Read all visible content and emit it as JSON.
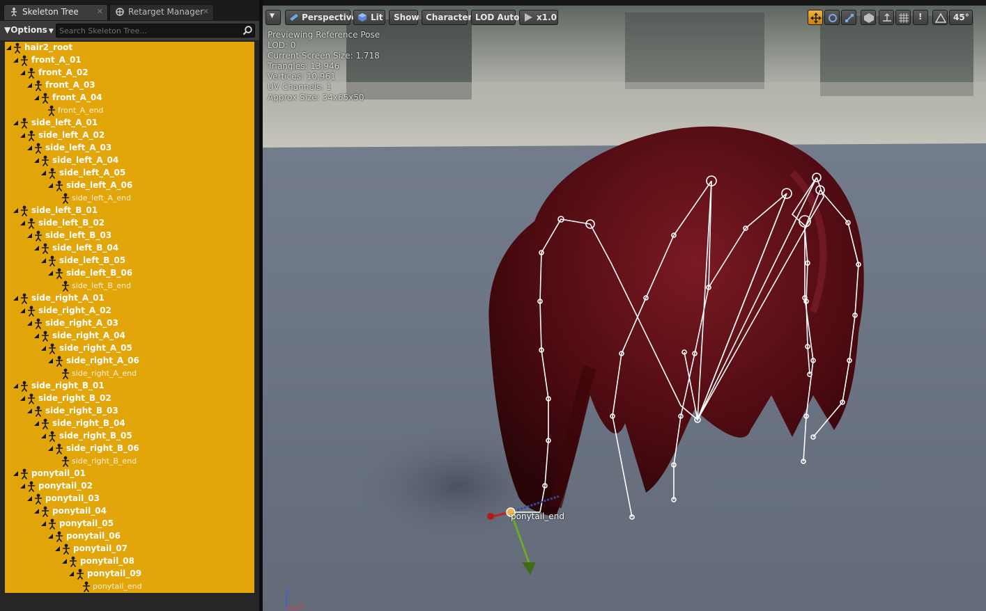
{
  "tabs": [
    {
      "label": "Skeleton Tree",
      "active": true
    },
    {
      "label": "Retarget Manager",
      "active": false
    }
  ],
  "toolbar": {
    "options_label": "Options"
  },
  "search": {
    "placeholder": "Search Skeleton Tree..."
  },
  "tree": [
    {
      "label": "hair2_root",
      "depth": 0
    },
    {
      "label": "front_A_01",
      "depth": 1
    },
    {
      "label": "front_A_02",
      "depth": 2
    },
    {
      "label": "front_A_03",
      "depth": 3
    },
    {
      "label": "front_A_04",
      "depth": 4
    },
    {
      "label": "front_A_end",
      "depth": 5,
      "leaf": true
    },
    {
      "label": "side_left_A_01",
      "depth": 1
    },
    {
      "label": "side_left_A_02",
      "depth": 2
    },
    {
      "label": "side_left_A_03",
      "depth": 3
    },
    {
      "label": "side_left_A_04",
      "depth": 4
    },
    {
      "label": "side_left_A_05",
      "depth": 5
    },
    {
      "label": "side_left_A_06",
      "depth": 6
    },
    {
      "label": "side_left_A_end",
      "depth": 7,
      "leaf": true
    },
    {
      "label": "side_left_B_01",
      "depth": 1
    },
    {
      "label": "side_left_B_02",
      "depth": 2
    },
    {
      "label": "side_left_B_03",
      "depth": 3
    },
    {
      "label": "side_left_B_04",
      "depth": 4
    },
    {
      "label": "side_left_B_05",
      "depth": 5
    },
    {
      "label": "side_left_B_06",
      "depth": 6
    },
    {
      "label": "side_left_B_end",
      "depth": 7,
      "leaf": true
    },
    {
      "label": "side_right_A_01",
      "depth": 1
    },
    {
      "label": "side_right_A_02",
      "depth": 2
    },
    {
      "label": "side_right_A_03",
      "depth": 3
    },
    {
      "label": "side_right_A_04",
      "depth": 4
    },
    {
      "label": "side_right_A_05",
      "depth": 5
    },
    {
      "label": "side_right_A_06",
      "depth": 6
    },
    {
      "label": "side_right_A_end",
      "depth": 7,
      "leaf": true
    },
    {
      "label": "side_right_B_01",
      "depth": 1
    },
    {
      "label": "side_right_B_02",
      "depth": 2
    },
    {
      "label": "side_right_B_03",
      "depth": 3
    },
    {
      "label": "side_right_B_04",
      "depth": 4
    },
    {
      "label": "side_right_B_05",
      "depth": 5
    },
    {
      "label": "side_right_B_06",
      "depth": 6
    },
    {
      "label": "side_right_B_end",
      "depth": 7,
      "leaf": true
    },
    {
      "label": "ponytail_01",
      "depth": 1
    },
    {
      "label": "ponytail_02",
      "depth": 2
    },
    {
      "label": "ponytail_03",
      "depth": 3
    },
    {
      "label": "ponytail_04",
      "depth": 4
    },
    {
      "label": "ponytail_05",
      "depth": 5
    },
    {
      "label": "ponytail_06",
      "depth": 6
    },
    {
      "label": "ponytail_07",
      "depth": 7
    },
    {
      "label": "ponytail_08",
      "depth": 8
    },
    {
      "label": "ponytail_09",
      "depth": 9
    },
    {
      "label": "ponytail_end",
      "depth": 10,
      "leaf": true
    }
  ],
  "viewport": {
    "perspective": "Perspective",
    "lit": "Lit",
    "show": "Show",
    "character": "Character",
    "lod": "LOD Auto",
    "speed": "x1.0",
    "angle": "45°",
    "stats": [
      "Previewing Reference Pose",
      "LOD: 0",
      "Current Screen Size: 1.718",
      "Triangles: 13,946",
      "Vertices: 10,961",
      "UV Channels: 1",
      "Approx Size: 34x65x50"
    ],
    "selected_bone": "ponytail_end",
    "axes": {
      "z": "Z",
      "x": "X"
    }
  },
  "colors": {
    "tree_background": "#e2a50a",
    "hair": "#5a0c12",
    "floor": "#67707f",
    "active_toggle": "#e8a126"
  },
  "icons": [
    "skeleton-icon",
    "retarget-icon",
    "close-icon",
    "filter-icon",
    "dropdown-icon",
    "search-icon",
    "bone-icon",
    "expand-icon",
    "camera-icon",
    "lit-sphere-icon",
    "play-icon",
    "translate-icon",
    "rotate-icon",
    "scale-icon",
    "world-local-icon",
    "surface-snap-icon",
    "grid-snap-icon",
    "angle-snap-icon"
  ]
}
